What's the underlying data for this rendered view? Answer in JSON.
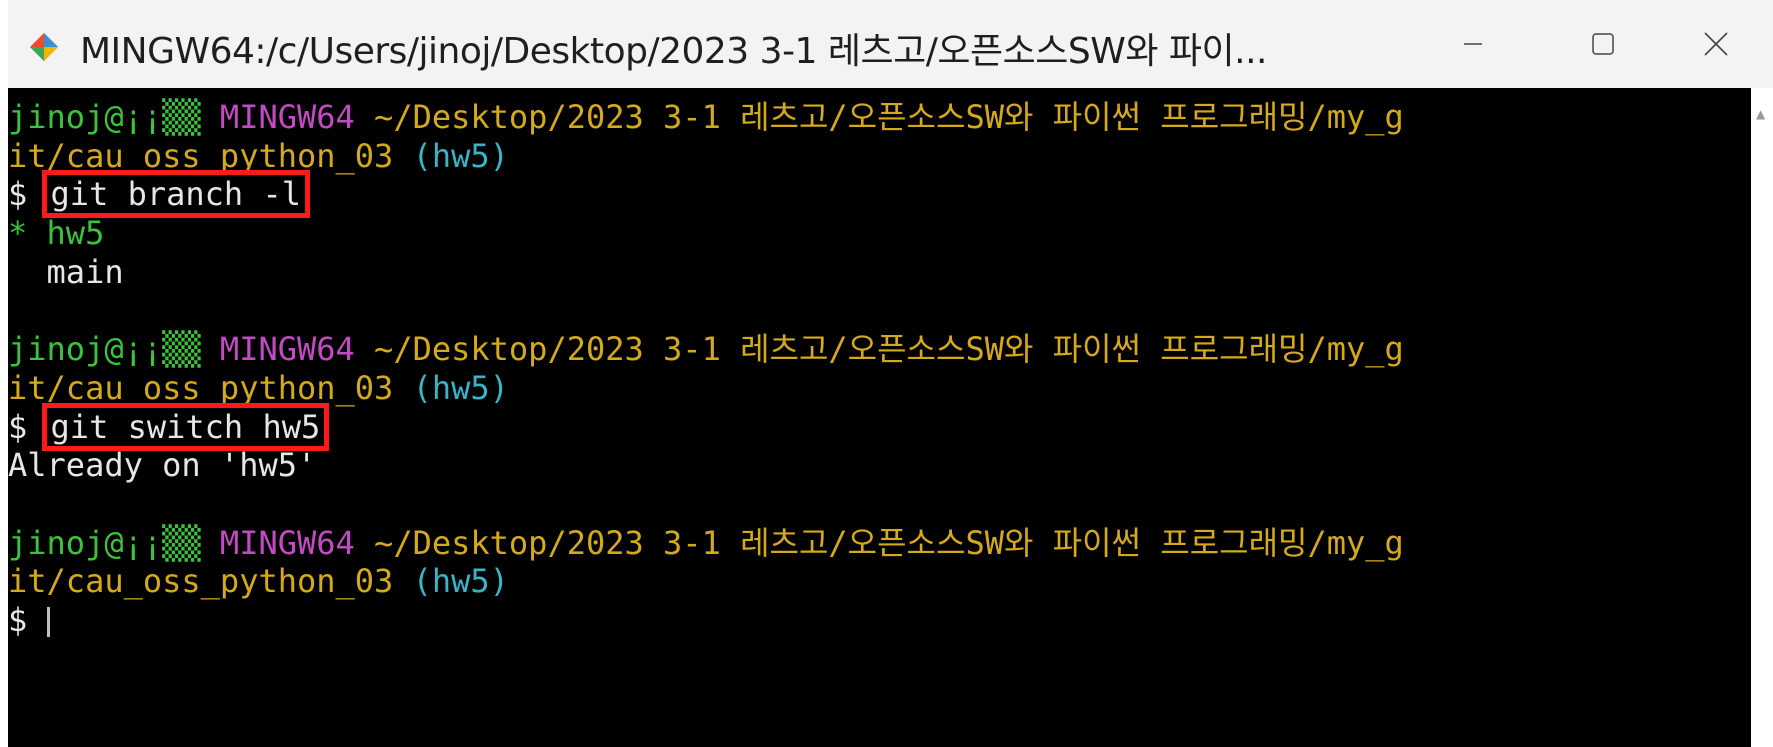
{
  "window": {
    "title": "MINGW64:/c/Users/jinoj/Desktop/2023 3-1 레츠고/오픈소스SW와 파이...",
    "controls": {
      "minimize": "—",
      "maximize": "☐",
      "close": "✕"
    }
  },
  "terminal": {
    "prompt_blocks": [
      {
        "user": "jinoj@¡¡▒▒",
        "system": "MINGW64",
        "path_line1": "~/Desktop/2023 3-1 레츠고/오픈소스SW와 파이썬 프로그래밍/my_g",
        "path_line2": "it/cau_oss_python_03",
        "branch": "(hw5)",
        "command": "git branch -l",
        "output": [
          "* hw5",
          "  main"
        ]
      },
      {
        "user": "jinoj@¡¡▒▒",
        "system": "MINGW64",
        "path_line1": "~/Desktop/2023 3-1 레츠고/오픈소스SW와 파이썬 프로그래밍/my_g",
        "path_line2": "it/cau_oss_python_03",
        "branch": "(hw5)",
        "command": "git switch hw5",
        "output": [
          "Already on 'hw5'"
        ]
      },
      {
        "user": "jinoj@¡¡▒▒",
        "system": "MINGW64",
        "path_line1": "~/Desktop/2023 3-1 레츠고/오픈소스SW와 파이썬 프로그래밍/my_g",
        "path_line2": "it/cau_oss_python_03",
        "branch": "(hw5)",
        "command": ""
      }
    ],
    "prompt_symbol": "$",
    "colors": {
      "background": "#000000",
      "user": "#3cc23c",
      "system": "#c24ac2",
      "path": "#d4a91a",
      "branch": "#39b5c7",
      "text": "#e6e6e6",
      "highlight_box": "#ff1a1a"
    }
  }
}
